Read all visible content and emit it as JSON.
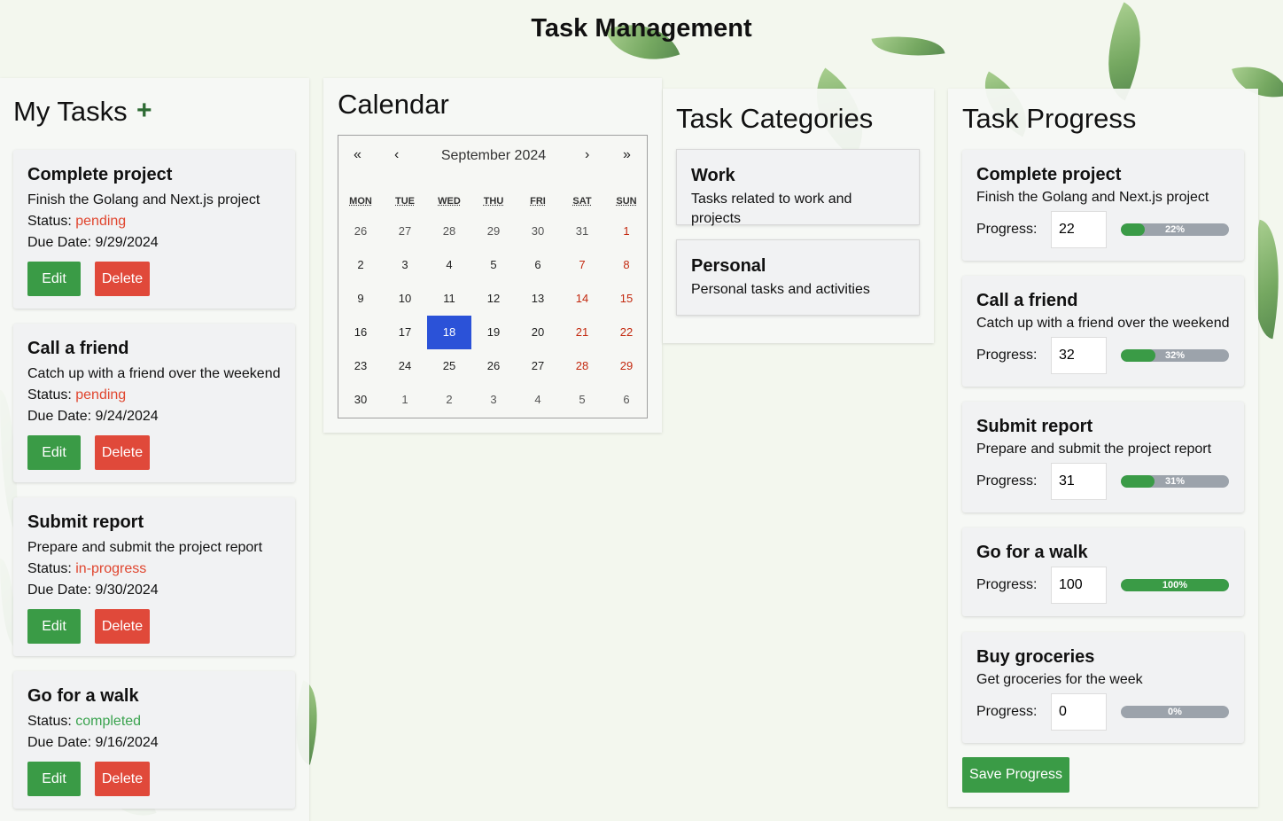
{
  "app_title": "Task Management",
  "tasks_panel": {
    "heading": "My Tasks",
    "add_label": "+",
    "status_prefix": "Status: ",
    "due_prefix": "Due Date: ",
    "edit_label": "Edit",
    "delete_label": "Delete",
    "items": [
      {
        "title": "Complete project",
        "description": "Finish the Golang and Next.js project",
        "status": "pending",
        "due": "9/29/2024"
      },
      {
        "title": "Call a friend",
        "description": "Catch up with a friend over the weekend",
        "status": "pending",
        "due": "9/24/2024"
      },
      {
        "title": "Submit report",
        "description": "Prepare and submit the project report",
        "status": "in-progress",
        "due": "9/30/2024"
      },
      {
        "title": "Go for a walk",
        "description": "",
        "status": "completed",
        "due": "9/16/2024"
      }
    ]
  },
  "calendar": {
    "heading": "Calendar",
    "month_label": "September 2024",
    "nav": {
      "prev_year": "«",
      "prev_month": "‹",
      "next_month": "›",
      "next_year": "»"
    },
    "weekdays": [
      "MON",
      "TUE",
      "WED",
      "THU",
      "FRI",
      "SAT",
      "SUN"
    ],
    "weeks": [
      [
        "26",
        "27",
        "28",
        "29",
        "30",
        "31",
        "1"
      ],
      [
        "2",
        "3",
        "4",
        "5",
        "6",
        "7",
        "8"
      ],
      [
        "9",
        "10",
        "11",
        "12",
        "13",
        "14",
        "15"
      ],
      [
        "16",
        "17",
        "18",
        "19",
        "20",
        "21",
        "22"
      ],
      [
        "23",
        "24",
        "25",
        "26",
        "27",
        "28",
        "29"
      ],
      [
        "30",
        "1",
        "2",
        "3",
        "4",
        "5",
        "6"
      ]
    ],
    "selected_day": "18"
  },
  "categories": {
    "heading": "Task Categories",
    "items": [
      {
        "name": "Work",
        "description": "Tasks related to work and projects"
      },
      {
        "name": "Personal",
        "description": "Personal tasks and activities"
      }
    ]
  },
  "progress": {
    "heading": "Task Progress",
    "label": "Progress:",
    "save_label": "Save Progress",
    "items": [
      {
        "title": "Complete project",
        "description": "Finish the Golang and Next.js project",
        "value": "22",
        "percent": 22,
        "percent_text": "22%"
      },
      {
        "title": "Call a friend",
        "description": "Catch up with a friend over the weekend",
        "value": "32",
        "percent": 32,
        "percent_text": "32%"
      },
      {
        "title": "Submit report",
        "description": "Prepare and submit the project report",
        "value": "31",
        "percent": 31,
        "percent_text": "31%"
      },
      {
        "title": "Go for a walk",
        "description": "",
        "value": "100",
        "percent": 100,
        "percent_text": "100%"
      },
      {
        "title": "Buy groceries",
        "description": "Get groceries for the week",
        "value": "0",
        "percent": 0,
        "percent_text": "0%"
      }
    ]
  },
  "colors": {
    "accent_green": "#3a9b46",
    "delete_red": "#e0493a",
    "pending_red": "#e0462f",
    "completed_green": "#3ba34f",
    "calendar_selected": "#2b52d8"
  }
}
